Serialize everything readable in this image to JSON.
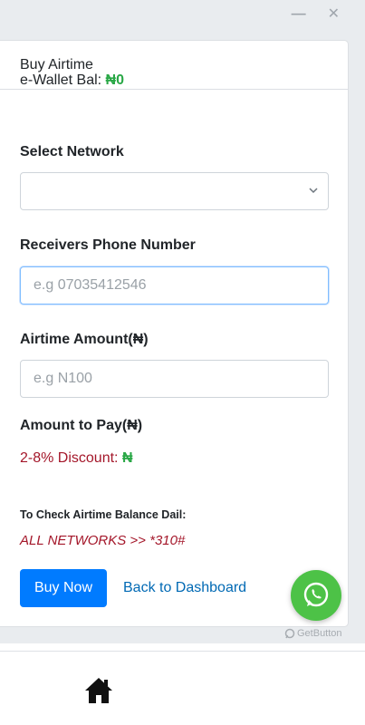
{
  "window": {
    "minimize_icon": "minimize-icon",
    "close_icon": "close-icon"
  },
  "card": {
    "title": "Buy Airtime"
  },
  "wallet": {
    "label": "e-Wallet Bal: ",
    "amount": "₦0"
  },
  "network": {
    "label": "Select Network",
    "selected": ""
  },
  "phone": {
    "label": "Receivers Phone Number",
    "placeholder": "e.g 07035412546"
  },
  "amount": {
    "label": "Airtime Amount(₦)",
    "placeholder": "e.g N100"
  },
  "pay": {
    "label": "Amount to Pay(₦)"
  },
  "discount": {
    "label": "2-8% Discount: ",
    "value": "₦"
  },
  "balance_check": {
    "title": "To Check Airtime Balance Dail:",
    "codes": "ALL NETWORKS >> *310#"
  },
  "actions": {
    "buy_label": "Buy Now",
    "back_label": "Back to Dashboard"
  },
  "widget": {
    "label": "GetButton",
    "icon": "whatsapp-icon"
  },
  "nav": {
    "home_icon": "home-icon"
  },
  "colors": {
    "primary": "#007bff",
    "success": "#28a745",
    "danger": "#a4172a",
    "whatsapp": "#4dc247",
    "link": "#0069b4"
  }
}
